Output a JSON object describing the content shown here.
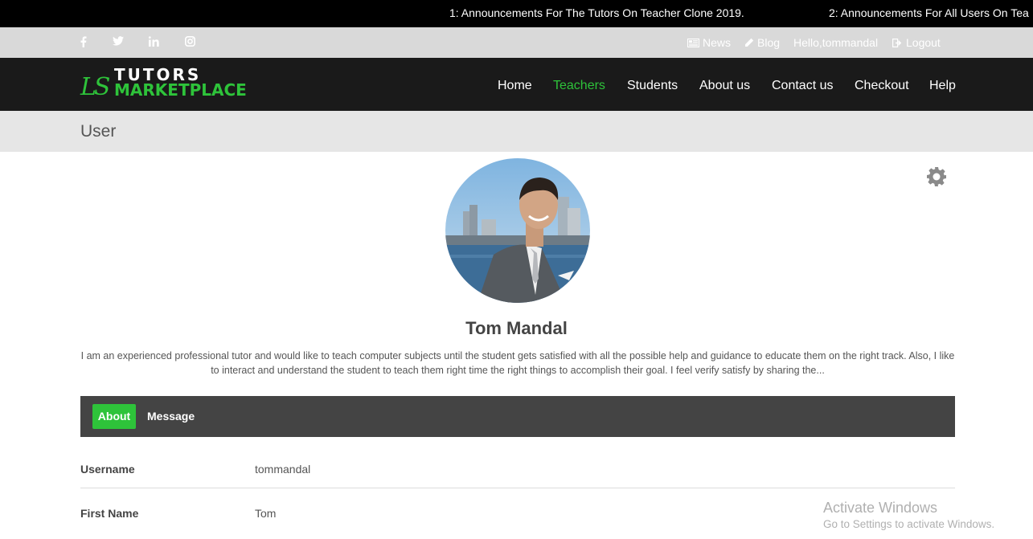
{
  "ticker": {
    "items": [
      "1: Announcements For The Tutors On Teacher Clone 2019.",
      "2: Announcements For All Users On Tea"
    ]
  },
  "topbar": {
    "social_icons": [
      "facebook-icon",
      "twitter-icon",
      "linkedin-icon",
      "instagram-icon"
    ],
    "news_label": "News",
    "blog_label": "Blog",
    "hello_label": "Hello,tommandal",
    "logout_label": "Logout"
  },
  "brand": {
    "mark": "LS",
    "line1": "TUTORS",
    "line2": "MARKETPLACE",
    "accent_color": "#2ec33a"
  },
  "nav": {
    "items": [
      "Home",
      "Teachers",
      "Students",
      "About us",
      "Contact us",
      "Checkout",
      "Help"
    ],
    "active": "Teachers"
  },
  "page": {
    "title": "User"
  },
  "profile": {
    "name": "Tom Mandal",
    "bio": "I am an experienced professional tutor and would like to teach computer subjects until the student gets satisfied with all the possible help and guidance to educate them on the right track. Also, I like to interact and understand the student to teach them right time the right things to accomplish their goal. I feel verify satisfy by sharing the...",
    "settings_icon": "gear-icon"
  },
  "tabs": {
    "about": "About",
    "message": "Message"
  },
  "details": [
    {
      "label": "Username",
      "value": "tommandal"
    },
    {
      "label": "First Name",
      "value": "Tom"
    }
  ],
  "watermark": {
    "line1": "Activate Windows",
    "line2": "Go to Settings to activate Windows."
  }
}
